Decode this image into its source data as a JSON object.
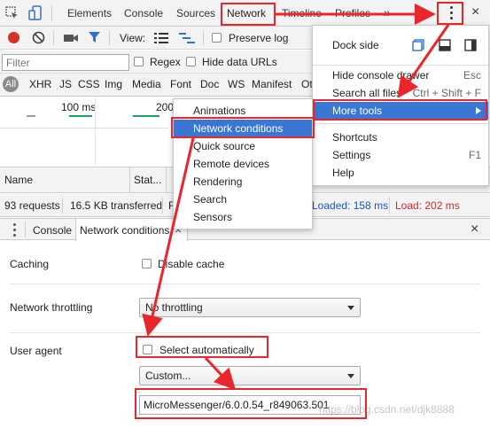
{
  "toolbar": {
    "tabs": [
      "Elements",
      "Console",
      "Sources",
      "Network",
      "Timeline",
      "Profiles"
    ],
    "more_label": "»"
  },
  "net_toolbar": {
    "view_label": "View:",
    "preserve_log": "Preserve log"
  },
  "filter": {
    "placeholder": "Filter",
    "regex": "Regex",
    "hide_data_urls": "Hide data URLs"
  },
  "types": [
    "All",
    "XHR",
    "JS",
    "CSS",
    "Img",
    "Media",
    "Font",
    "Doc",
    "WS",
    "Manifest",
    "Ot"
  ],
  "timeline": {
    "tick1": "100 ms",
    "tick2": "200"
  },
  "columns": {
    "name": "Name",
    "status": "Stat..."
  },
  "status_bar": {
    "requests": "93 requests",
    "transferred": "16.5 KB transferred",
    "loaded": "Loaded: 158 ms",
    "load": "Load: 202 ms",
    "f": "F"
  },
  "drawer": {
    "tab_console": "Console",
    "tab_network_conditions": "Network conditions",
    "close": "×"
  },
  "conditions": {
    "caching_label": "Caching",
    "disable_cache": "Disable cache",
    "throttling_label": "Network throttling",
    "throttling_value": "No throttling",
    "user_agent_label": "User agent",
    "select_automatically": "Select automatically",
    "ua_select_value": "Custom...",
    "ua_input_value": "MicroMessenger/6.0.0.54_r849063.501"
  },
  "main_menu": {
    "dock_side": "Dock side",
    "hide_console_drawer": "Hide console drawer",
    "hide_console_shortcut": "Esc",
    "search_all_files": "Search all files",
    "search_all_shortcut": "Ctrl + Shift + F",
    "more_tools": "More tools",
    "shortcuts": "Shortcuts",
    "settings": "Settings",
    "settings_shortcut": "F1",
    "help": "Help"
  },
  "submenu": {
    "items": [
      "Animations",
      "Network conditions",
      "Quick source",
      "Remote devices",
      "Rendering",
      "Search",
      "Sensors"
    ]
  },
  "watermark": "https://blog.csdn.net/djk8888",
  "colors": {
    "annotation_red": "#e8262b",
    "menu_highlight": "#3a77d4",
    "record_red": "#d93025",
    "loaded_blue": "#1a56c4",
    "load_red": "#d42a2a"
  }
}
